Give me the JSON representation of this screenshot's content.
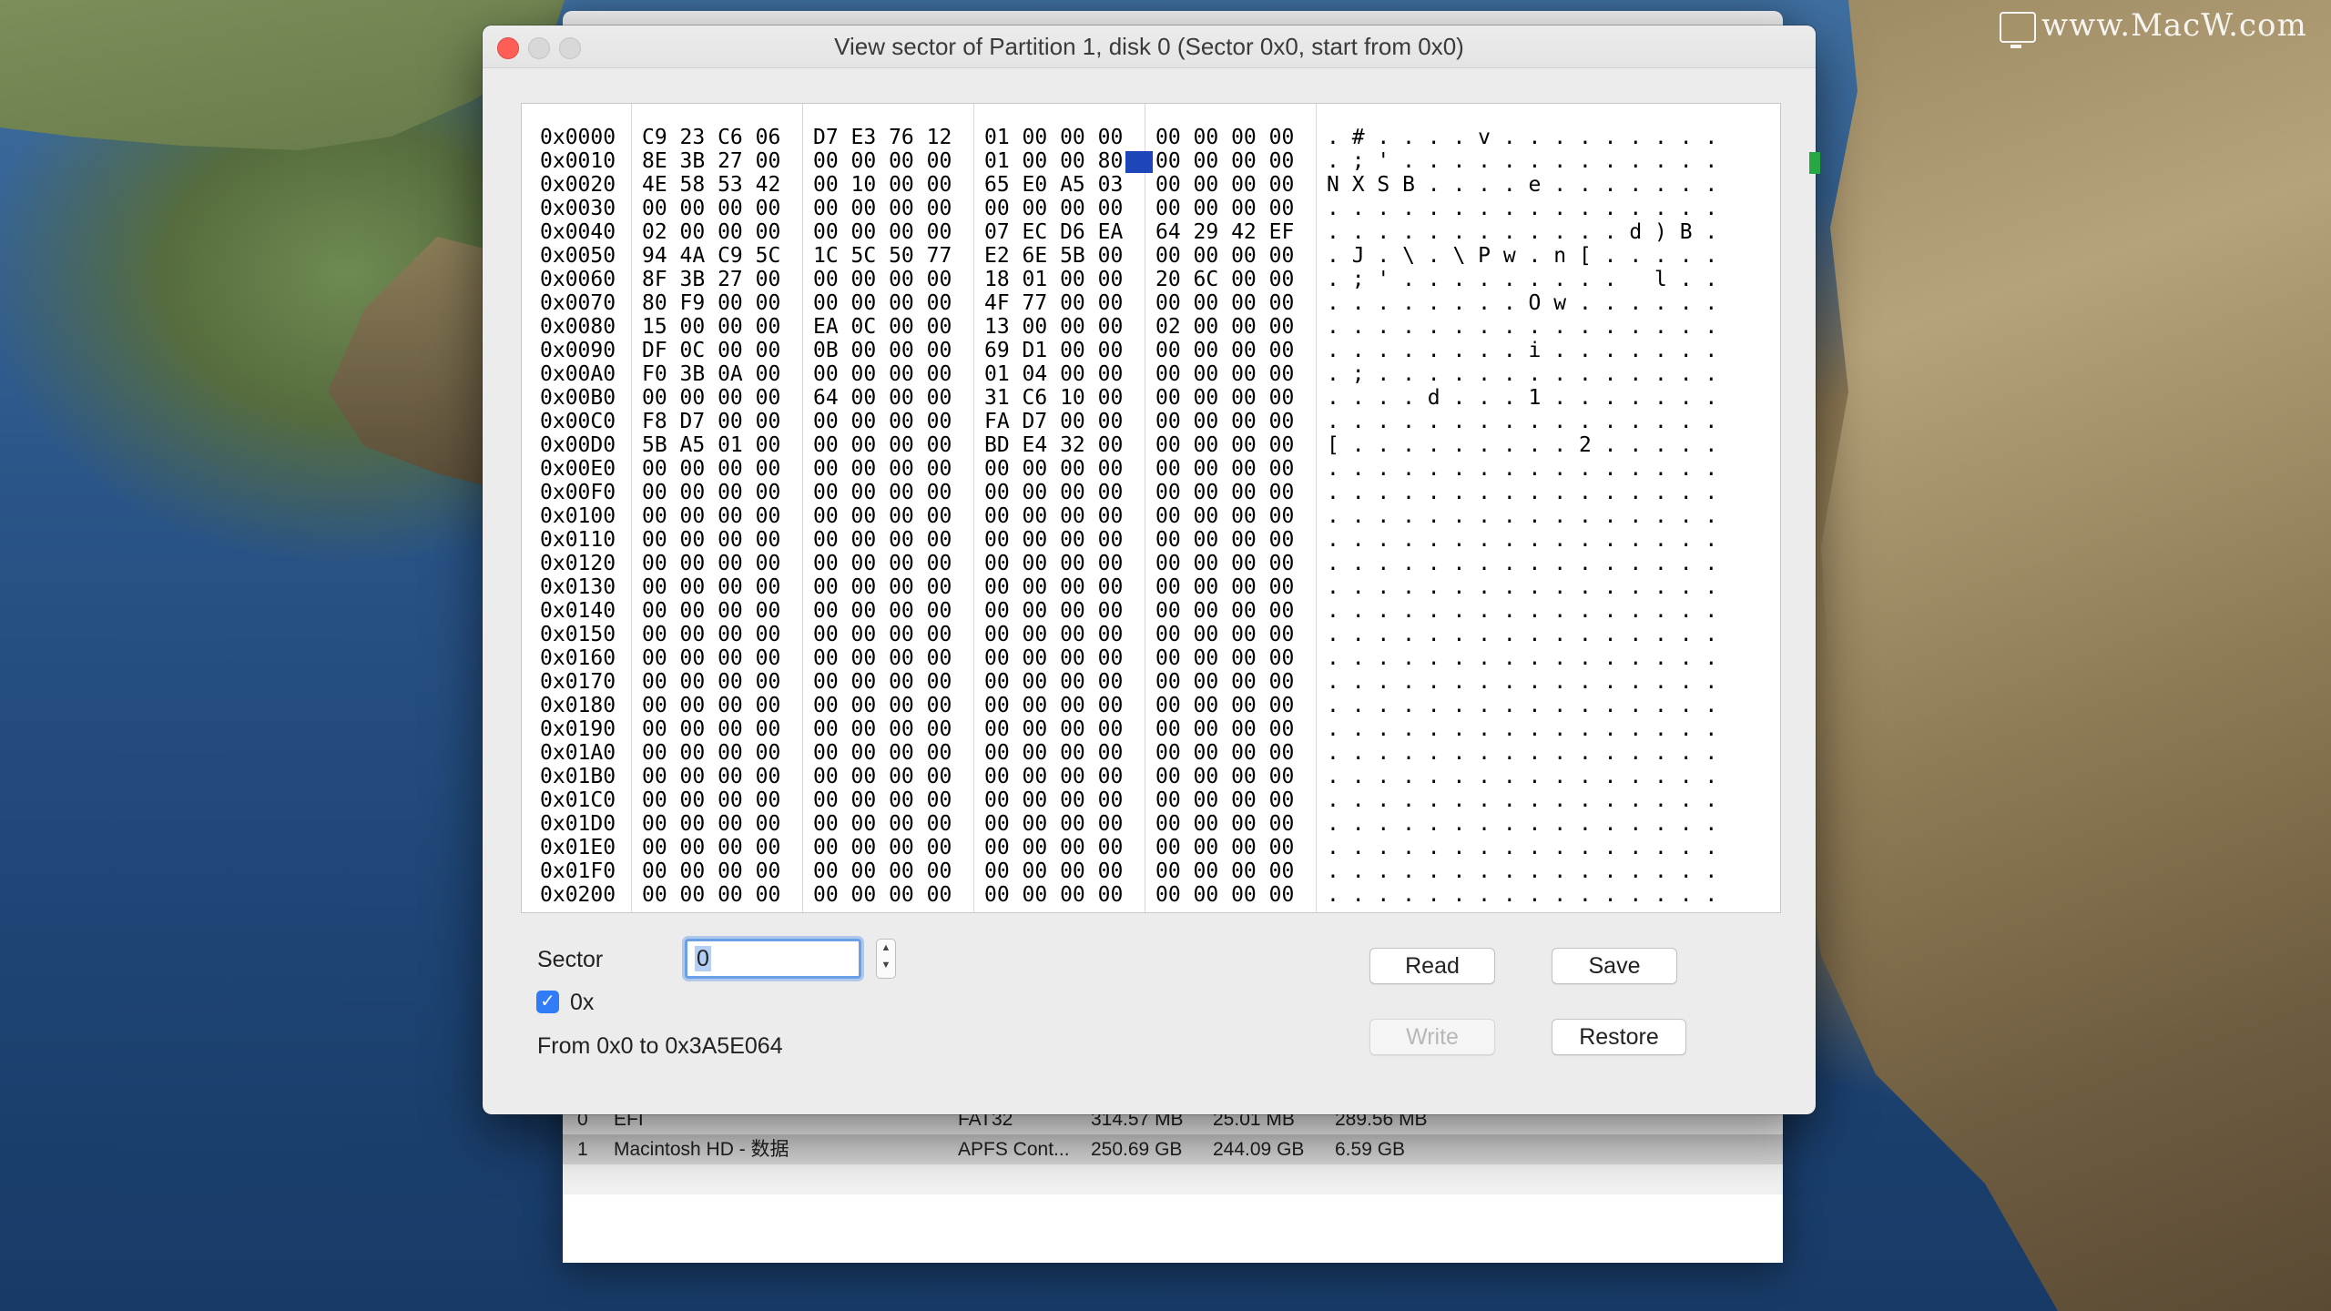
{
  "watermark": "www.MacW.com",
  "background_window": {
    "list_rows": [
      {
        "index": "0",
        "name": "EFI",
        "type": "FAT32",
        "size": "314.57 MB",
        "used": "25.01 MB",
        "free": "289.56 MB"
      },
      {
        "index": "1",
        "name": "Macintosh HD - 数据",
        "type": "APFS Cont...",
        "size": "250.69 GB",
        "used": "244.09 GB",
        "free": "6.59 GB"
      }
    ]
  },
  "dialog": {
    "title": "View sector of Partition 1, disk 0 (Sector 0x0, start from 0x0)",
    "hex_rows": [
      {
        "addr": "0x0000",
        "g1": "C9 23 C6 06",
        "g2": "D7 E3 76 12",
        "g3": "01 00 00 00",
        "g4": "00 00 00 00",
        "ascii": ". # . . . . v . . . . . . . . ."
      },
      {
        "addr": "0x0010",
        "g1": "8E 3B 27 00",
        "g2": "00 00 00 00",
        "g3": "01 00 00 80",
        "g4": "00 00 00 00",
        "ascii": ". ; ' . . . . . . . . . . . . ."
      },
      {
        "addr": "0x0020",
        "g1": "4E 58 53 42",
        "g2": "00 10 00 00",
        "g3": "65 E0 A5 03",
        "g4": "00 00 00 00",
        "ascii": "N X S B . . . . e . . . . . . ."
      },
      {
        "addr": "0x0030",
        "g1": "00 00 00 00",
        "g2": "00 00 00 00",
        "g3": "00 00 00 00",
        "g4": "00 00 00 00",
        "ascii": ". . . . . . . . . . . . . . . ."
      },
      {
        "addr": "0x0040",
        "g1": "02 00 00 00",
        "g2": "00 00 00 00",
        "g3": "07 EC D6 EA",
        "g4": "64 29 42 EF",
        "ascii": ". . . . . . . . . . . . d ) B ."
      },
      {
        "addr": "0x0050",
        "g1": "94 4A C9 5C",
        "g2": "1C 5C 50 77",
        "g3": "E2 6E 5B 00",
        "g4": "00 00 00 00",
        "ascii": ". J . \\ . \\ P w . n [ . . . . ."
      },
      {
        "addr": "0x0060",
        "g1": "8F 3B 27 00",
        "g2": "00 00 00 00",
        "g3": "18 01 00 00",
        "g4": "20 6C 00 00",
        "ascii": ". ; ' . . . . . . . . .   l . ."
      },
      {
        "addr": "0x0070",
        "g1": "80 F9 00 00",
        "g2": "00 00 00 00",
        "g3": "4F 77 00 00",
        "g4": "00 00 00 00",
        "ascii": ". . . . . . . . O w . . . . . ."
      },
      {
        "addr": "0x0080",
        "g1": "15 00 00 00",
        "g2": "EA 0C 00 00",
        "g3": "13 00 00 00",
        "g4": "02 00 00 00",
        "ascii": ". . . . . . . . . . . . . . . ."
      },
      {
        "addr": "0x0090",
        "g1": "DF 0C 00 00",
        "g2": "0B 00 00 00",
        "g3": "69 D1 00 00",
        "g4": "00 00 00 00",
        "ascii": ". . . . . . . . i . . . . . . ."
      },
      {
        "addr": "0x00A0",
        "g1": "F0 3B 0A 00",
        "g2": "00 00 00 00",
        "g3": "01 04 00 00",
        "g4": "00 00 00 00",
        "ascii": ". ; . . . . . . . . . . . . . ."
      },
      {
        "addr": "0x00B0",
        "g1": "00 00 00 00",
        "g2": "64 00 00 00",
        "g3": "31 C6 10 00",
        "g4": "00 00 00 00",
        "ascii": ". . . . d . . . 1 . . . . . . ."
      },
      {
        "addr": "0x00C0",
        "g1": "F8 D7 00 00",
        "g2": "00 00 00 00",
        "g3": "FA D7 00 00",
        "g4": "00 00 00 00",
        "ascii": ". . . . . . . . . . . . . . . ."
      },
      {
        "addr": "0x00D0",
        "g1": "5B A5 01 00",
        "g2": "00 00 00 00",
        "g3": "BD E4 32 00",
        "g4": "00 00 00 00",
        "ascii": "[ . . . . . . . . . 2 . . . . ."
      },
      {
        "addr": "0x00E0",
        "g1": "00 00 00 00",
        "g2": "00 00 00 00",
        "g3": "00 00 00 00",
        "g4": "00 00 00 00",
        "ascii": ". . . . . . . . . . . . . . . ."
      },
      {
        "addr": "0x00F0",
        "g1": "00 00 00 00",
        "g2": "00 00 00 00",
        "g3": "00 00 00 00",
        "g4": "00 00 00 00",
        "ascii": ". . . . . . . . . . . . . . . ."
      },
      {
        "addr": "0x0100",
        "g1": "00 00 00 00",
        "g2": "00 00 00 00",
        "g3": "00 00 00 00",
        "g4": "00 00 00 00",
        "ascii": ". . . . . . . . . . . . . . . ."
      },
      {
        "addr": "0x0110",
        "g1": "00 00 00 00",
        "g2": "00 00 00 00",
        "g3": "00 00 00 00",
        "g4": "00 00 00 00",
        "ascii": ". . . . . . . . . . . . . . . ."
      },
      {
        "addr": "0x0120",
        "g1": "00 00 00 00",
        "g2": "00 00 00 00",
        "g3": "00 00 00 00",
        "g4": "00 00 00 00",
        "ascii": ". . . . . . . . . . . . . . . ."
      },
      {
        "addr": "0x0130",
        "g1": "00 00 00 00",
        "g2": "00 00 00 00",
        "g3": "00 00 00 00",
        "g4": "00 00 00 00",
        "ascii": ". . . . . . . . . . . . . . . ."
      },
      {
        "addr": "0x0140",
        "g1": "00 00 00 00",
        "g2": "00 00 00 00",
        "g3": "00 00 00 00",
        "g4": "00 00 00 00",
        "ascii": ". . . . . . . . . . . . . . . ."
      },
      {
        "addr": "0x0150",
        "g1": "00 00 00 00",
        "g2": "00 00 00 00",
        "g3": "00 00 00 00",
        "g4": "00 00 00 00",
        "ascii": ". . . . . . . . . . . . . . . ."
      },
      {
        "addr": "0x0160",
        "g1": "00 00 00 00",
        "g2": "00 00 00 00",
        "g3": "00 00 00 00",
        "g4": "00 00 00 00",
        "ascii": ". . . . . . . . . . . . . . . ."
      },
      {
        "addr": "0x0170",
        "g1": "00 00 00 00",
        "g2": "00 00 00 00",
        "g3": "00 00 00 00",
        "g4": "00 00 00 00",
        "ascii": ". . . . . . . . . . . . . . . ."
      },
      {
        "addr": "0x0180",
        "g1": "00 00 00 00",
        "g2": "00 00 00 00",
        "g3": "00 00 00 00",
        "g4": "00 00 00 00",
        "ascii": ". . . . . . . . . . . . . . . ."
      },
      {
        "addr": "0x0190",
        "g1": "00 00 00 00",
        "g2": "00 00 00 00",
        "g3": "00 00 00 00",
        "g4": "00 00 00 00",
        "ascii": ". . . . . . . . . . . . . . . ."
      },
      {
        "addr": "0x01A0",
        "g1": "00 00 00 00",
        "g2": "00 00 00 00",
        "g3": "00 00 00 00",
        "g4": "00 00 00 00",
        "ascii": ". . . . . . . . . . . . . . . ."
      },
      {
        "addr": "0x01B0",
        "g1": "00 00 00 00",
        "g2": "00 00 00 00",
        "g3": "00 00 00 00",
        "g4": "00 00 00 00",
        "ascii": ". . . . . . . . . . . . . . . ."
      },
      {
        "addr": "0x01C0",
        "g1": "00 00 00 00",
        "g2": "00 00 00 00",
        "g3": "00 00 00 00",
        "g4": "00 00 00 00",
        "ascii": ". . . . . . . . . . . . . . . ."
      },
      {
        "addr": "0x01D0",
        "g1": "00 00 00 00",
        "g2": "00 00 00 00",
        "g3": "00 00 00 00",
        "g4": "00 00 00 00",
        "ascii": ". . . . . . . . . . . . . . . ."
      },
      {
        "addr": "0x01E0",
        "g1": "00 00 00 00",
        "g2": "00 00 00 00",
        "g3": "00 00 00 00",
        "g4": "00 00 00 00",
        "ascii": ". . . . . . . . . . . . . . . ."
      },
      {
        "addr": "0x01F0",
        "g1": "00 00 00 00",
        "g2": "00 00 00 00",
        "g3": "00 00 00 00",
        "g4": "00 00 00 00",
        "ascii": ". . . . . . . . . . . . . . . ."
      },
      {
        "addr": "0x0200",
        "g1": "00 00 00 00",
        "g2": "00 00 00 00",
        "g3": "00 00 00 00",
        "g4": "00 00 00 00",
        "ascii": ". . . . . . . . . . . . . . . ."
      }
    ],
    "sector_label": "Sector",
    "sector_value": "0",
    "hex_checkbox_label": "0x",
    "hex_checkbox_checked": true,
    "range_text": "From 0x0 to 0x3A5E064",
    "buttons": {
      "read": "Read",
      "save": "Save",
      "write": "Write",
      "restore": "Restore"
    },
    "write_enabled": false
  }
}
